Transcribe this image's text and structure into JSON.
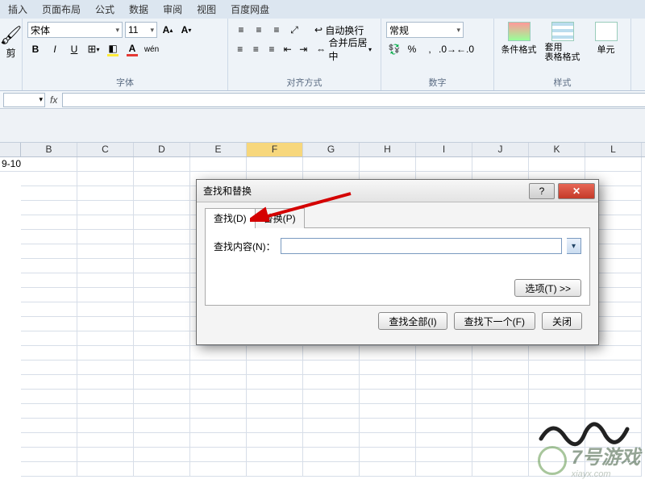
{
  "menu": {
    "items": [
      "插入",
      "页面布局",
      "公式",
      "数据",
      "审阅",
      "视图",
      "百度网盘"
    ]
  },
  "ribbon": {
    "font": {
      "name": "宋体",
      "size": "11",
      "group_label": "字体",
      "bold": "B",
      "italic": "I",
      "underline": "U"
    },
    "clipboard": {
      "label": "剪"
    },
    "align": {
      "group_label": "对齐方式",
      "wrap": "自动换行",
      "merge": "合并后居中"
    },
    "number": {
      "group_label": "数字",
      "format": "常规",
      "percent": "%",
      "comma": ","
    },
    "styles": {
      "group_label": "样式",
      "cond": "条件格式",
      "tbl": "套用\n表格格式",
      "cell": "单元"
    }
  },
  "formula_bar": {
    "fx": "fx"
  },
  "columns": [
    "B",
    "C",
    "D",
    "E",
    "F",
    "G",
    "H",
    "I",
    "J",
    "K",
    "L"
  ],
  "cell_a1": "9-10",
  "dialog": {
    "title": "查找和替换",
    "tab_find": "查找(D)",
    "tab_replace": "替换(P)",
    "find_label": "查找内容(N)：",
    "find_value": "",
    "options": "选项(T) >>",
    "find_all": "查找全部(I)",
    "find_next": "查找下一个(F)",
    "close": "关闭"
  },
  "watermark": {
    "text": "7号游戏",
    "sub": "xiayx.com"
  }
}
